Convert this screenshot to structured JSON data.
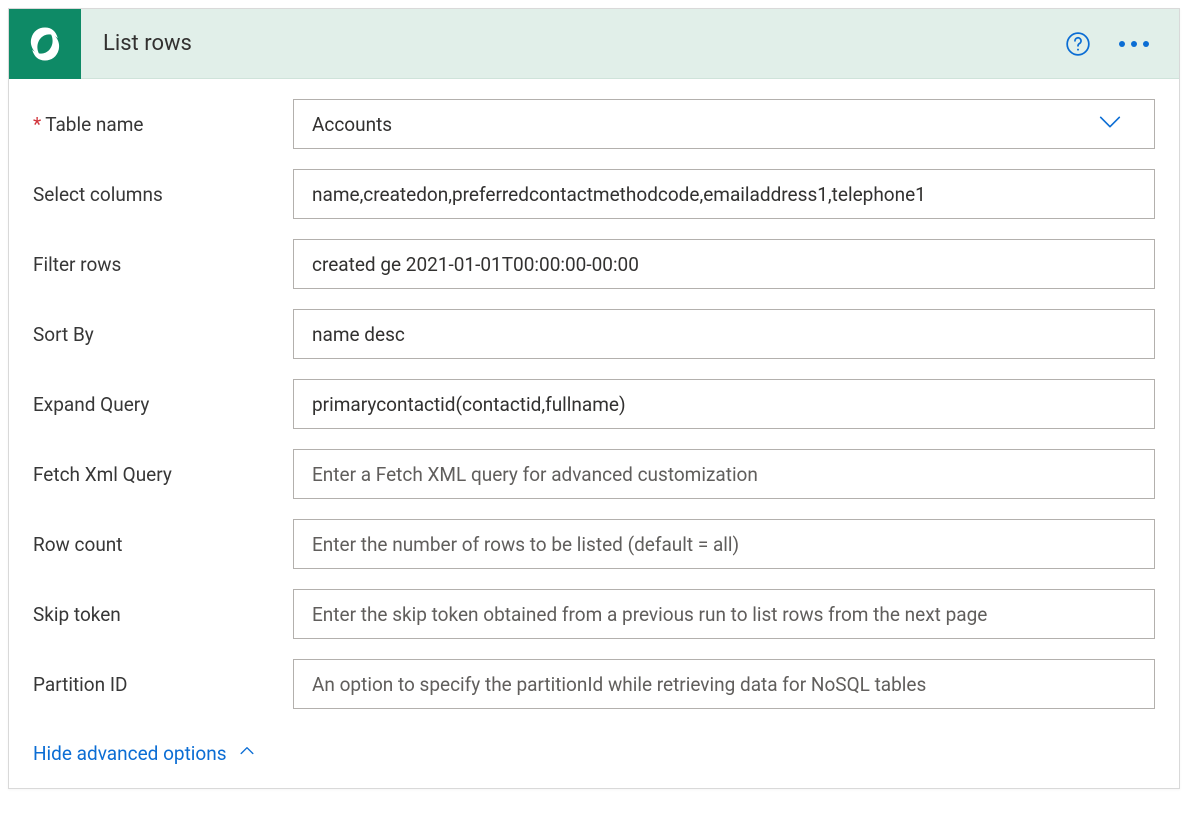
{
  "header": {
    "title": "List rows"
  },
  "fields": {
    "table_name": {
      "label": "Table name",
      "required": true,
      "value": "Accounts"
    },
    "select_cols": {
      "label": "Select columns",
      "value": "name,createdon,preferredcontactmethodcode,emailaddress1,telephone1"
    },
    "filter_rows": {
      "label": "Filter rows",
      "value": "created ge 2021-01-01T00:00:00-00:00"
    },
    "sort_by": {
      "label": "Sort By",
      "value": "name desc"
    },
    "expand_query": {
      "label": "Expand Query",
      "value": "primarycontactid(contactid,fullname)"
    },
    "fetch_xml": {
      "label": "Fetch Xml Query",
      "placeholder": "Enter a Fetch XML query for advanced customization"
    },
    "row_count": {
      "label": "Row count",
      "placeholder": "Enter the number of rows to be listed (default = all)"
    },
    "skip_token": {
      "label": "Skip token",
      "placeholder": "Enter the skip token obtained from a previous run to list rows from the next page"
    },
    "partition_id": {
      "label": "Partition ID",
      "placeholder": "An option to specify the partitionId while retrieving data for NoSQL tables"
    }
  },
  "footer": {
    "toggle_label": "Hide advanced options"
  }
}
